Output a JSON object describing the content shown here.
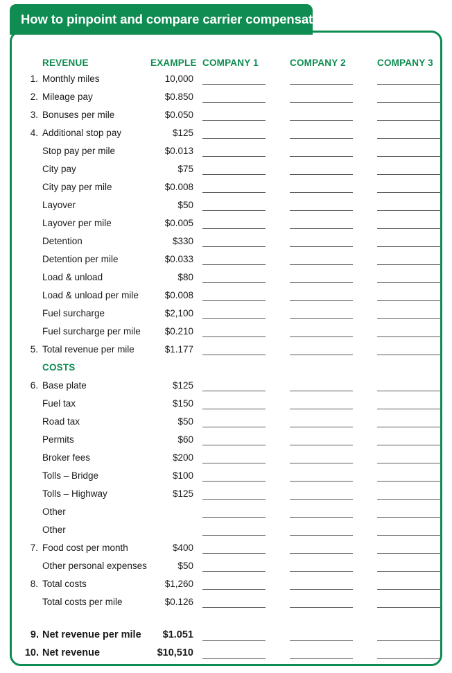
{
  "title": "How to pinpoint and compare carrier compensation",
  "colors": {
    "brand_green": "#0e8c51",
    "text": "#1a1a1a",
    "rule": "#58595b"
  },
  "columns": {
    "revenue_header": "REVENUE",
    "costs_header": "COSTS",
    "example_header": "EXAMPLE",
    "company_1": "COMPANY 1",
    "company_2": "COMPANY 2",
    "company_3": "COMPANY 3"
  },
  "rows": [
    {
      "num": "1.",
      "label": "Monthly miles",
      "example": "10,000",
      "lines": true
    },
    {
      "num": "2.",
      "label": "Mileage pay",
      "example": "$0.850",
      "lines": true
    },
    {
      "num": "3.",
      "label": "Bonuses per mile",
      "example": "$0.050",
      "lines": true
    },
    {
      "num": "4.",
      "label": "Additional stop pay",
      "example": "$125",
      "lines": true
    },
    {
      "num": "",
      "label": "Stop pay per mile",
      "example": "$0.013",
      "lines": true
    },
    {
      "num": "",
      "label": "City pay",
      "example": "$75",
      "lines": true
    },
    {
      "num": "",
      "label": "City pay per mile",
      "example": "$0.008",
      "lines": true
    },
    {
      "num": "",
      "label": "Layover",
      "example": "$50",
      "lines": true
    },
    {
      "num": "",
      "label": "Layover per mile",
      "example": "$0.005",
      "lines": true
    },
    {
      "num": "",
      "label": "Detention",
      "example": "$330",
      "lines": true
    },
    {
      "num": "",
      "label": "Detention per mile",
      "example": "$0.033",
      "lines": true
    },
    {
      "num": "",
      "label": "Load & unload",
      "example": "$80",
      "lines": true
    },
    {
      "num": "",
      "label": "Load & unload per mile",
      "example": "$0.008",
      "lines": true
    },
    {
      "num": "",
      "label": "Fuel surcharge",
      "example": "$2,100",
      "lines": true
    },
    {
      "num": "",
      "label": "Fuel surcharge per mile",
      "example": "$0.210",
      "lines": true
    },
    {
      "num": "5.",
      "label": "Total revenue per mile",
      "example": "$1.177",
      "lines": true
    },
    {
      "num": "",
      "label": "COSTS",
      "example": "",
      "lines": false,
      "kind": "section"
    },
    {
      "num": "6.",
      "label": "Base plate",
      "example": "$125",
      "lines": true
    },
    {
      "num": "",
      "label": "Fuel tax",
      "example": "$150",
      "lines": true
    },
    {
      "num": "",
      "label": "Road tax",
      "example": "$50",
      "lines": true
    },
    {
      "num": "",
      "label": "Permits",
      "example": "$60",
      "lines": true
    },
    {
      "num": "",
      "label": "Broker fees",
      "example": "$200",
      "lines": true
    },
    {
      "num": "",
      "label": "Tolls – Bridge",
      "example": "$100",
      "lines": true
    },
    {
      "num": "",
      "label": "Tolls – Highway",
      "example": "$125",
      "lines": true
    },
    {
      "num": "",
      "label": "Other",
      "example": "",
      "lines": true
    },
    {
      "num": "",
      "label": "Other",
      "example": "",
      "lines": true
    },
    {
      "num": "7.",
      "label": "Food cost per month",
      "example": "$400",
      "lines": true
    },
    {
      "num": "",
      "label": "Other personal expenses",
      "example": "$50",
      "lines": true
    },
    {
      "num": "8.",
      "label": "Total costs",
      "example": "$1,260",
      "lines": true
    },
    {
      "num": "",
      "label": "Total costs per mile",
      "example": "$0.126",
      "lines": true
    },
    {
      "num": "",
      "label": "",
      "example": "",
      "lines": false,
      "kind": "spacer"
    },
    {
      "num": "9.",
      "label": "Net revenue per mile",
      "example": "$1.051",
      "lines": true,
      "kind": "total"
    },
    {
      "num": "10.",
      "label": "Net revenue",
      "example": "$10,510",
      "lines": true,
      "kind": "total"
    }
  ]
}
